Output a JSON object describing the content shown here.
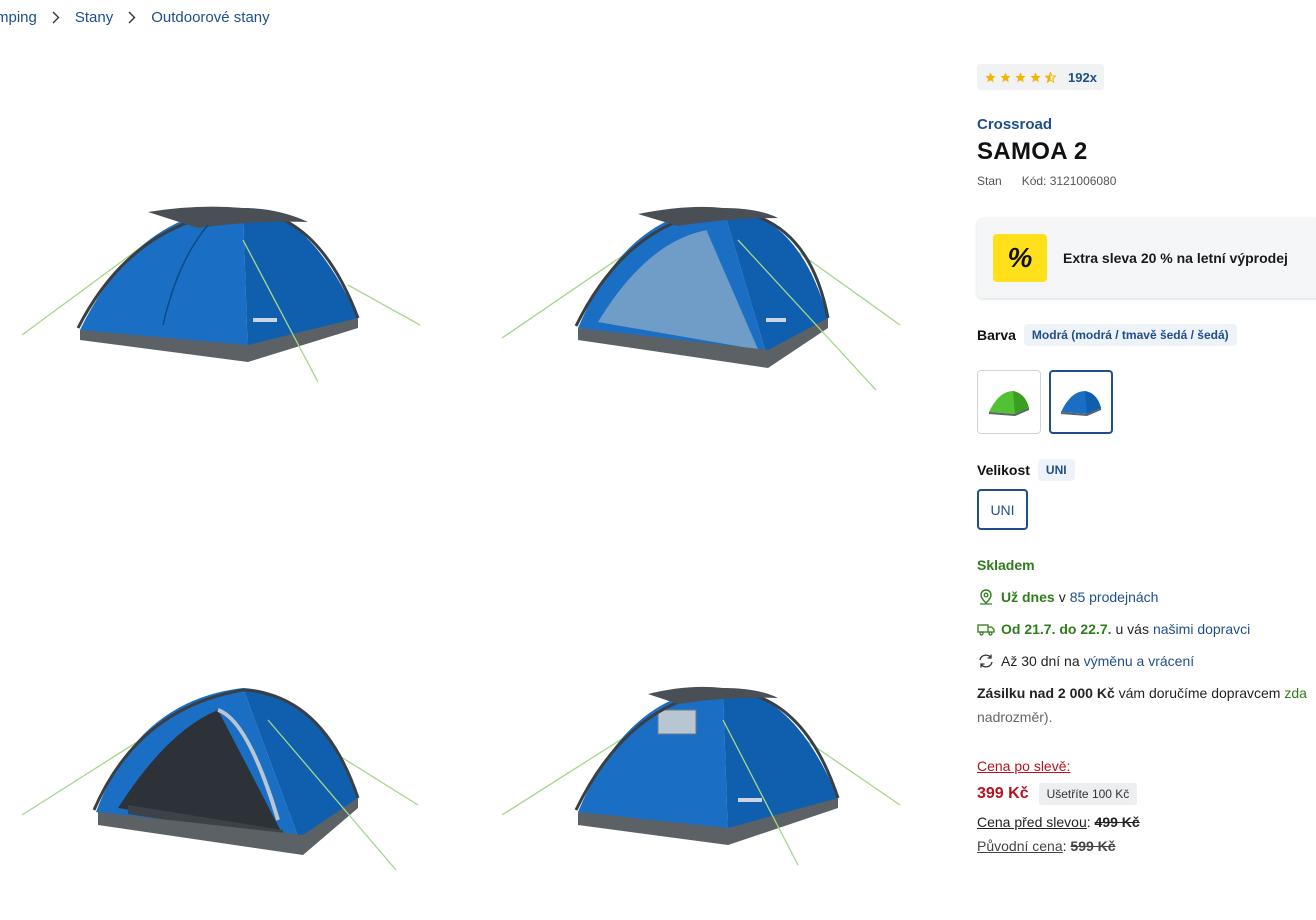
{
  "breadcrumb": {
    "items": [
      "mping",
      "Stany",
      "Outdoorové stany"
    ]
  },
  "gallery": {
    "images": [
      {
        "alt": "tent-closed-front-right"
      },
      {
        "alt": "tent-mesh-door-open"
      },
      {
        "alt": "tent-door-open-interior"
      },
      {
        "alt": "tent-back-window"
      }
    ]
  },
  "product": {
    "rating": {
      "stars": 4.5,
      "count": "192x"
    },
    "brand": "Crossroad",
    "title": "SAMOA 2",
    "type": "Stan",
    "code": "Kód: 3121006080"
  },
  "promo": {
    "badge": "%",
    "text": "Extra sleva 20 % na letní výprodej"
  },
  "variants": {
    "color_label": "Barva",
    "color_value": "Modrá (modrá / tmavě šedá / šedá)",
    "size_label": "Velikost",
    "size_value": "UNI",
    "size_option": "UNI"
  },
  "availability": {
    "stock": "Skladem",
    "store_strong": "Už dnes",
    "store_mid": "v",
    "store_link": "85 prodejnách",
    "delivery_strong": "Od 21.7. do 22.7.",
    "delivery_mid": "u vás",
    "delivery_link": "našimi dopravci",
    "return_text": "Až 30 dní na",
    "return_link": "výměnu a vrácení",
    "shipping_bold": "Zásilku nad 2 000 Kč",
    "shipping_text": "vám doručíme dopravcem",
    "shipping_green": "zda",
    "shipping_line2": "nadrozměr)."
  },
  "price": {
    "label": "Cena po slevě",
    "label_suffix": ":",
    "value": "399 Kč",
    "save": "Ušetříte 100 Kč",
    "before_label": "Cena před slevou",
    "before_value": "499 Kč",
    "original_label": "Původní cena",
    "original_value": "599 Kč"
  },
  "colors": {
    "link": "#1f4f8a",
    "stock_green": "#2e7d1a",
    "price_red": "#b3141d",
    "promo_yellow": "#ffe01b",
    "star": "#f5b400"
  }
}
